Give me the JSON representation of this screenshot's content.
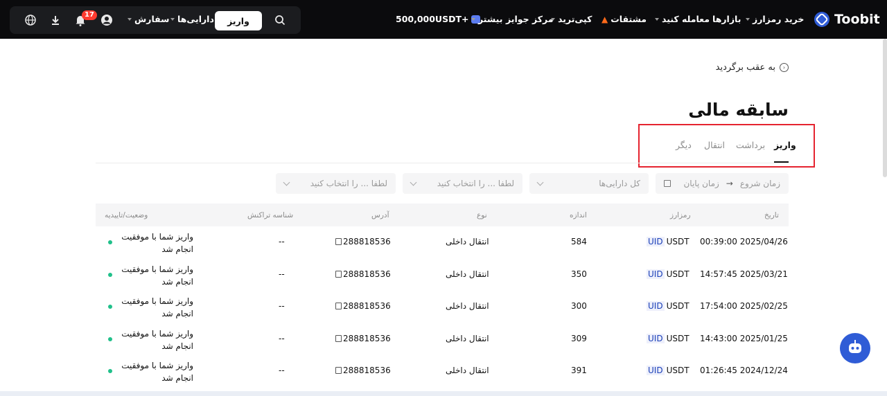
{
  "nav": {
    "logo_text": "Toobit",
    "buy_crypto": "خرید رمزارز",
    "markets": "بازارها",
    "trade": "معامله کنید",
    "derivatives": "مشتقات",
    "copytrade": "کپی‌ترید",
    "rewards_center": "مرکز جوایز",
    "more": "بیشتر",
    "bonus": "500,000USDT+",
    "deposit": "واریز",
    "assets": "دارایی‌ها",
    "orders": "سفارش",
    "notification_count": "17"
  },
  "page": {
    "back": "به عقب برگردید",
    "title": "سابقه مالی"
  },
  "tabs": [
    "واریز",
    "برداشت",
    "انتقال",
    "دیگر"
  ],
  "filters": {
    "start_time": "زمان شروع",
    "end_time": "زمان پایان",
    "all_assets": "کل دارایی‌ها",
    "select_1": "لطفا ... را انتخاب کنید",
    "select_2": "لطفا ... را انتخاب کنید"
  },
  "table": {
    "headers": {
      "date": "تاریخ",
      "crypto": "رمزارز",
      "amount": "اندازه",
      "type": "نوع",
      "address": "آدرس",
      "txid": "شناسه تراکنش",
      "status": "وضعیت/تاییدیه"
    },
    "rows": [
      {
        "date": "00:39:00 2025/04/26",
        "uid": "UID",
        "coin": "USDT",
        "amount": "584",
        "type": "انتقال داخلی",
        "address": "288818536",
        "txid": "--",
        "status_1": "واریز شما با موفقیت",
        "status_2": "انجام شد"
      },
      {
        "date": "14:57:45 2025/03/21",
        "uid": "UID",
        "coin": "USDT",
        "amount": "350",
        "type": "انتقال داخلی",
        "address": "288818536",
        "txid": "--",
        "status_1": "واریز شما با موفقیت",
        "status_2": "انجام شد"
      },
      {
        "date": "17:54:00 2025/02/25",
        "uid": "UID",
        "coin": "USDT",
        "amount": "300",
        "type": "انتقال داخلی",
        "address": "288818536",
        "txid": "--",
        "status_1": "واریز شما با موفقیت",
        "status_2": "انجام شد"
      },
      {
        "date": "14:43:00 2025/01/25",
        "uid": "UID",
        "coin": "USDT",
        "amount": "309",
        "type": "انتقال داخلی",
        "address": "288818536",
        "txid": "--",
        "status_1": "واریز شما با موفقیت",
        "status_2": "انجام شد"
      },
      {
        "date": "01:26:45 2024/12/24",
        "uid": "UID",
        "coin": "USDT",
        "amount": "391",
        "type": "انتقال داخلی",
        "address": "288818536",
        "txid": "--",
        "status_1": "واریز شما با موفقیت",
        "status_2": "انجام شد"
      }
    ]
  },
  "colors": {
    "nav_bg": "#0b0b0d",
    "highlight_box": "#e5232f",
    "status_ok": "#20c08a",
    "uid_blue": "#1a3fb8"
  }
}
